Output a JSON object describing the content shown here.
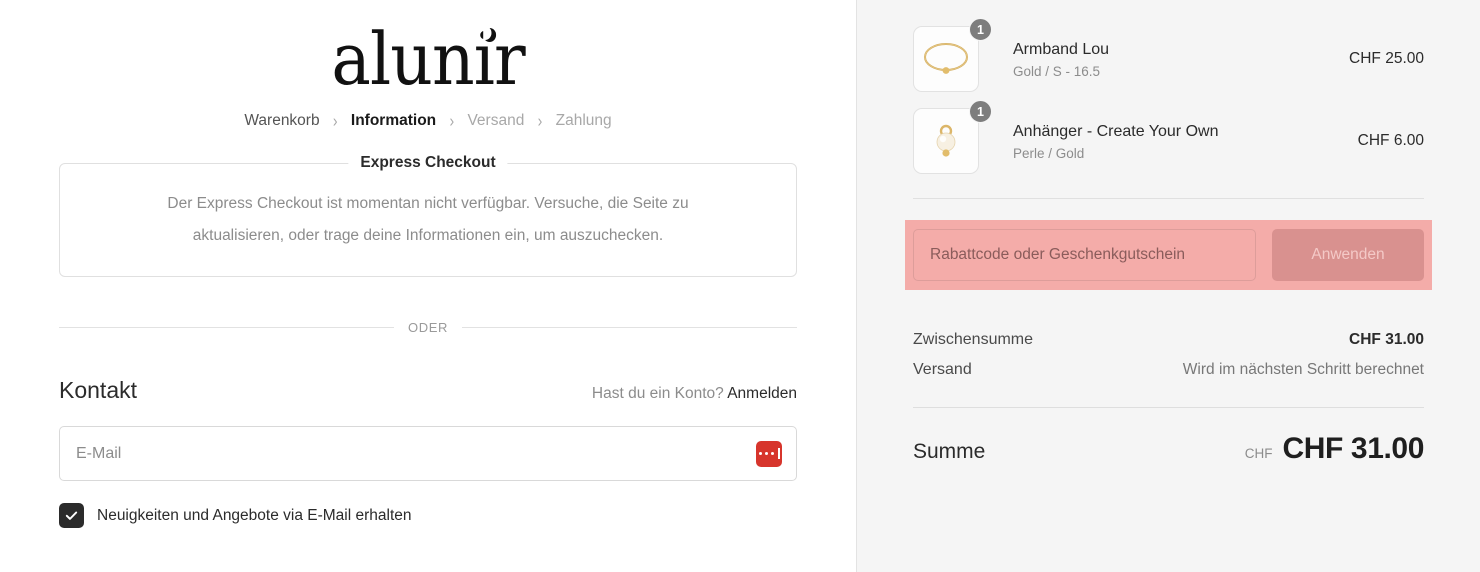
{
  "brand": {
    "logo_text": "alunir",
    "moon_icon": "crescent-moon-icon"
  },
  "breadcrumb": {
    "items": [
      {
        "label": "Warenkorb",
        "state": "done"
      },
      {
        "label": "Information",
        "state": "current"
      },
      {
        "label": "Versand",
        "state": "future"
      },
      {
        "label": "Zahlung",
        "state": "future"
      }
    ],
    "separator": "›"
  },
  "express": {
    "legend": "Express Checkout",
    "message": "Der Express Checkout ist momentan nicht verfügbar. Versuche, die Seite zu aktualisieren, oder trage deine Informationen ein, um auszuchecken."
  },
  "divider": {
    "label": "ODER"
  },
  "contact": {
    "title": "Kontakt",
    "account_prompt": "Hast du ein Konto?",
    "login_link": "Anmelden",
    "email_placeholder": "E-Mail",
    "email_value": "",
    "password_manager_icon": "lastpass-icon",
    "newsletter_label": "Neuigkeiten und Angebote via E-Mail erhalten",
    "newsletter_checked": true
  },
  "summary": {
    "items": [
      {
        "title": "Armband Lou",
        "variant": "Gold / S - 16.5",
        "price": "CHF 25.00",
        "qty": "1",
        "image": "gold-bracelet-thumbnail"
      },
      {
        "title": "Anhänger - Create Your Own",
        "variant": "Perle / Gold",
        "price": "CHF 6.00",
        "qty": "1",
        "image": "pearl-pendant-thumbnail"
      }
    ],
    "discount": {
      "placeholder": "Rabattcode oder Geschenkgutschein",
      "value": "",
      "apply_label": "Anwenden"
    },
    "totals": [
      {
        "label": "Zwischensumme",
        "value": "CHF 31.00",
        "muted": false
      },
      {
        "label": "Versand",
        "value": "Wird im nächsten Schritt berechnet",
        "muted": true
      }
    ],
    "grand": {
      "label": "Summe",
      "currency": "CHF",
      "value": "CHF 31.00"
    }
  },
  "colors": {
    "accent_highlight": "#f4aca9",
    "apply_button": "#d9918f",
    "panel_bg": "#f5f5f5",
    "lastpass_red": "#d7352c",
    "checkbox_dark": "#2b2b2b"
  }
}
